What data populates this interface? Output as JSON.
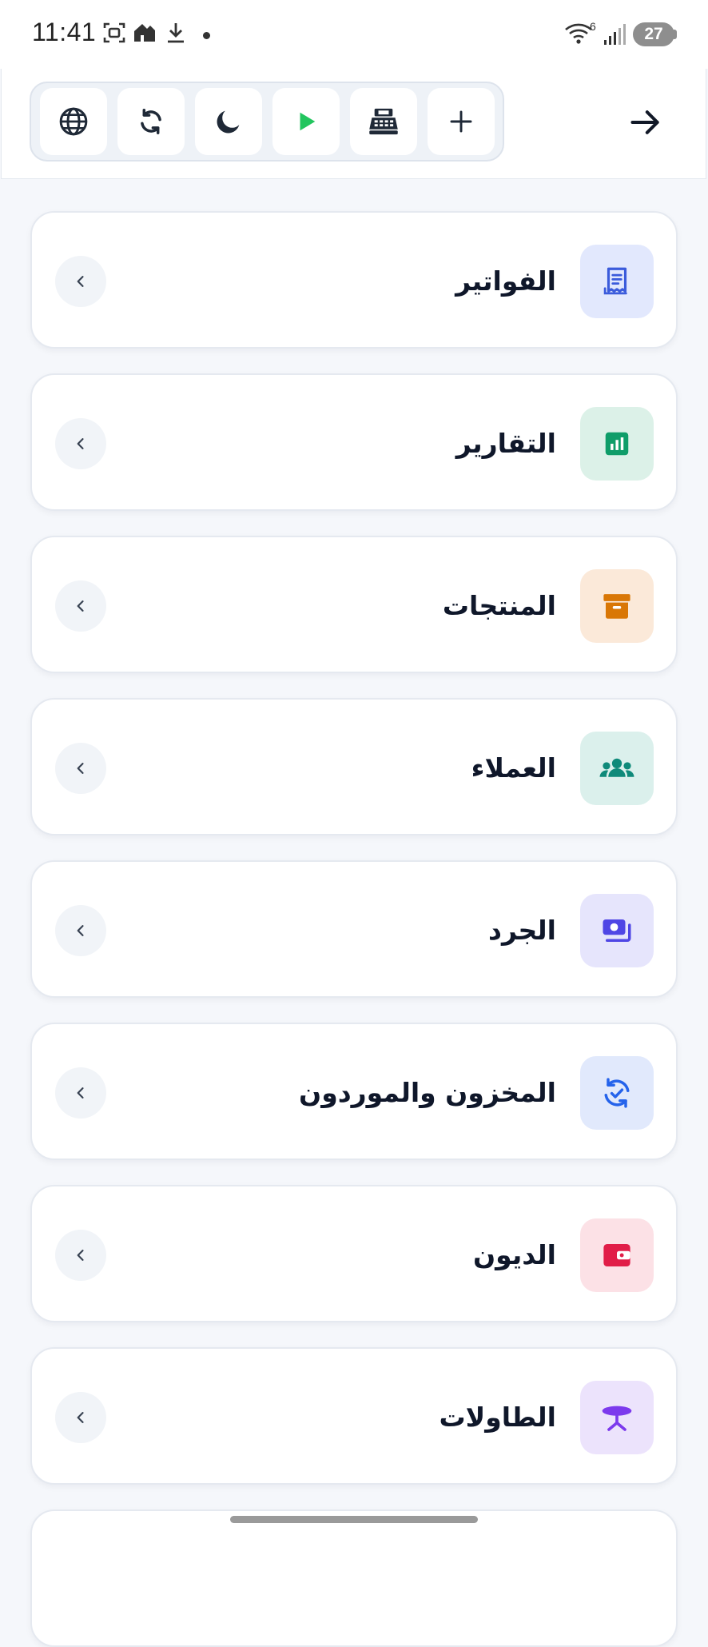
{
  "status_bar": {
    "time": "11:41",
    "network_generation": "6",
    "battery_level": "27"
  },
  "toolbar": {
    "buttons": [
      {
        "id": "language",
        "icon": "globe-icon"
      },
      {
        "id": "sync",
        "icon": "refresh-icon"
      },
      {
        "id": "theme",
        "icon": "moon-icon"
      },
      {
        "id": "play",
        "icon": "play-icon"
      },
      {
        "id": "cash-register",
        "icon": "cash-register-icon"
      },
      {
        "id": "add",
        "icon": "plus-icon"
      }
    ],
    "back_icon": "arrow-right-icon"
  },
  "menu": {
    "items": [
      {
        "label": "الفواتير",
        "icon": "receipt-icon",
        "icon_bg": "#e2e8fd",
        "icon_color": "#3b5bdb"
      },
      {
        "label": "التقارير",
        "icon": "chart-icon",
        "icon_bg": "#dcf1e8",
        "icon_color": "#0f9d69"
      },
      {
        "label": "المنتجات",
        "icon": "archive-box-icon",
        "icon_bg": "#fbe9d9",
        "icon_color": "#d97706"
      },
      {
        "label": "العملاء",
        "icon": "users-icon",
        "icon_bg": "#dbf0ec",
        "icon_color": "#0f8a7a"
      },
      {
        "label": "الجرد",
        "icon": "money-stack-icon",
        "icon_bg": "#e6e5fc",
        "icon_color": "#4f46e5"
      },
      {
        "label": "المخزون والموردون",
        "icon": "sync-check-icon",
        "icon_bg": "#e1e9fc",
        "icon_color": "#2563eb"
      },
      {
        "label": "الديون",
        "icon": "wallet-icon",
        "icon_bg": "#fce1e6",
        "icon_color": "#e11d48"
      },
      {
        "label": "الطاولات",
        "icon": "table-icon",
        "icon_bg": "#ece3fc",
        "icon_color": "#7c3aed"
      }
    ]
  }
}
